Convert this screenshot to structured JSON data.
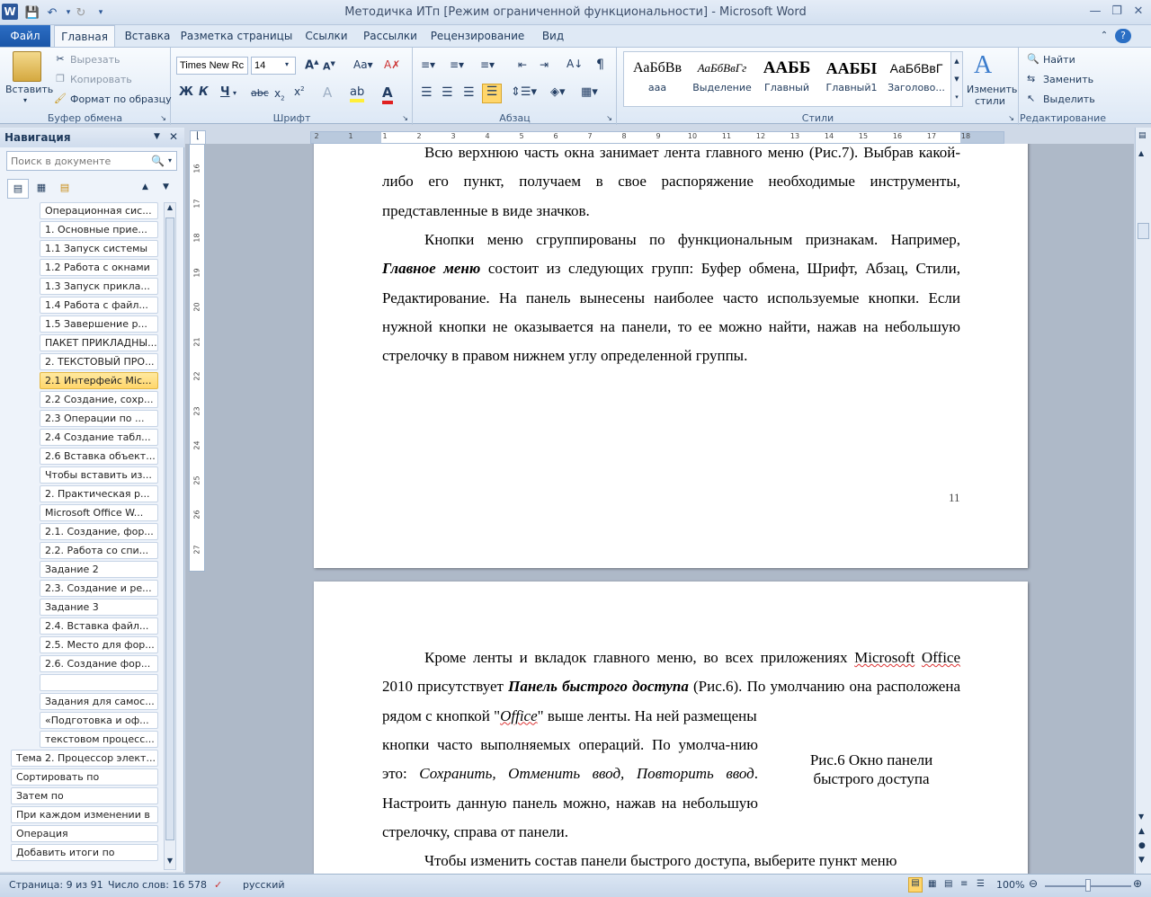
{
  "window": {
    "title": "Методичка ИТп  [Режим ограниченной функциональности]  -  Microsoft Word",
    "app_icon": "word-icon"
  },
  "tabs": [
    "Файл",
    "Главная",
    "Вставка",
    "Разметка страницы",
    "Ссылки",
    "Рассылки",
    "Рецензирование",
    "Вид"
  ],
  "ribbon": {
    "clipboard": {
      "paste": "Вставить",
      "cut": "Вырезать",
      "copy": "Копировать",
      "format_painter": "Формат по образцу",
      "label": "Буфер обмена"
    },
    "font": {
      "name": "Times New Rc",
      "size": "14",
      "label": "Шрифт"
    },
    "paragraph": {
      "label": "Абзац"
    },
    "styles": {
      "label": "Стили",
      "items": [
        {
          "sample": "АаБбВв",
          "name": "ааа"
        },
        {
          "sample": "АаБбВвГг",
          "name": "Выделение"
        },
        {
          "sample": "ААББ",
          "name": "Главный"
        },
        {
          "sample": "ААББІ",
          "name": "Главный1"
        },
        {
          "sample": "АаБбВвГ",
          "name": "Заголово..."
        }
      ],
      "change": "Изменить стили"
    },
    "editing": {
      "find": "Найти",
      "replace": "Заменить",
      "select": "Выделить",
      "label": "Редактирование"
    }
  },
  "nav": {
    "title": "Навигация",
    "search_placeholder": "Поиск в документе",
    "items": [
      {
        "label": "Операционная сис...",
        "level": 2
      },
      {
        "label": "1. Основные прие...",
        "level": 2
      },
      {
        "label": "1.1 Запуск системы",
        "level": 2
      },
      {
        "label": "1.2 Работа с окнами",
        "level": 2
      },
      {
        "label": "1.3  Запуск прикла...",
        "level": 2
      },
      {
        "label": "1.4   Работа с файл...",
        "level": 2
      },
      {
        "label": "1.5  Завершение р...",
        "level": 2
      },
      {
        "label": "ПАКЕТ ПРИКЛАДНЫ...",
        "level": 2
      },
      {
        "label": "2. ТЕКСТОВЫЙ ПРО...",
        "level": 2
      },
      {
        "label": "2.1  Интерфейс Mic...",
        "level": 2,
        "selected": true
      },
      {
        "label": "2.2 Создание, сохр...",
        "level": 2
      },
      {
        "label": "2.3  Операции по ...",
        "level": 2
      },
      {
        "label": "2.4  Создание табл...",
        "level": 2
      },
      {
        "label": "2.6 Вставка объект...",
        "level": 2
      },
      {
        "label": "Чтобы вставить из...",
        "level": 2
      },
      {
        "label": "2. Практическая р...",
        "level": 2
      },
      {
        "label": "Microsoft Office W...",
        "level": 2
      },
      {
        "label": "2.1. Создание, фор...",
        "level": 2
      },
      {
        "label": "2.2.  Работа со спи...",
        "level": 2
      },
      {
        "label": " Задание 2",
        "level": 2
      },
      {
        "label": "2.3.  Создание и ре...",
        "level": 2
      },
      {
        "label": "Задание 3",
        "level": 2
      },
      {
        "label": "2.4.   Вставка файл...",
        "level": 2
      },
      {
        "label": "2.5. Место для фор...",
        "level": 2
      },
      {
        "label": "2.6. Создание фор...",
        "level": 2
      },
      {
        "label": "",
        "level": 2
      },
      {
        "label": "Задания для самос...",
        "level": 2
      },
      {
        "label": "«Подготовка и оф...",
        "level": 2
      },
      {
        "label": "текстовом процесс...",
        "level": 2
      },
      {
        "label": "Тема 2. Процессор элект...",
        "level": 1
      },
      {
        "label": "  Сортировать по",
        "level": 1
      },
      {
        "label": "   Затем  по",
        "level": 1
      },
      {
        "label": " При каждом изменении в",
        "level": 1
      },
      {
        "label": "Операция",
        "level": 1
      },
      {
        "label": "Добавить итоги по",
        "level": 1
      }
    ]
  },
  "ruler": {
    "h_ticks": [
      "2",
      "1",
      "1",
      "2",
      "3",
      "4",
      "5",
      "6",
      "7",
      "8",
      "9",
      "10",
      "11",
      "12",
      "13",
      "14",
      "15",
      "16",
      "17",
      "18"
    ],
    "v_ticks": [
      "16",
      "17",
      "18",
      "19",
      "20",
      "21",
      "22",
      "23",
      "24",
      "25",
      "26",
      "27"
    ]
  },
  "document": {
    "page1": {
      "p1": "Всю верхнюю часть окна занимает лента главного меню (Рис.7). Выбрав какой-либо его пункт, получаем в свое распоряжение необходимые инструменты, представленные в виде значков.",
      "p2_a": "Кнопки меню сгруппированы по функциональным признакам. Например, ",
      "p2_bold": "Главное меню",
      "p2_b": " состоит из следующих групп: Буфер обмена, Шрифт, Абзац, Стили, Редактирование. На панель вынесены наиболее часто используемые кнопки. Если нужной кнопки не оказывается на панели, то ее можно найти, нажав на небольшую стрелочку в правом нижнем углу определенной группы.",
      "page_number": "11"
    },
    "page2": {
      "p1_a": "Кроме ленты и вкладок главного меню, во всех приложениях ",
      "p1_ms": "Microsoft",
      "p1_office": "Office",
      "p1_b": " 2010 присутствует ",
      "p1_bold": "Панель быстрого доступа",
      "p1_c": " (Рис.6). По умолчанию она расположена рядом с кнопкой \"",
      "p1_office2": "Office",
      "p1_d": "\" выше ленты. На ней размещены",
      "p2_a": "кнопки часто выполняемых операций. По умолча-нию это: ",
      "p2_it": "Сохранить, Отменить ввод, Повторить ввод",
      "p2_b": ". Настроить данную панель можно, нажав на небольшую стрелочку, справа от панели.",
      "caption": "Рис.6 Окно панели быстрого доступа",
      "p3": "Чтобы изменить состав панели быстрого доступа, выберите пункт меню"
    }
  },
  "status": {
    "page": "Страница: 9 из 91",
    "words": "Число слов: 16 578",
    "language": "русский",
    "zoom": "100%",
    "zoom_level": 1.0
  }
}
